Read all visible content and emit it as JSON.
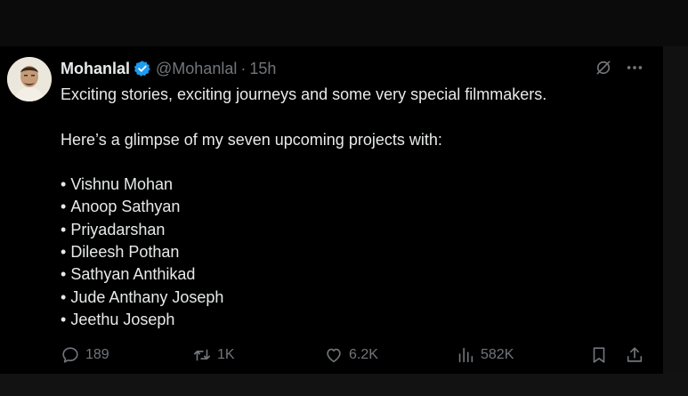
{
  "tweet": {
    "author_name": "Mohanlal",
    "handle": "@Mohanlal",
    "separator": "·",
    "time": "15h",
    "line1": "Exciting stories, exciting journeys and some very special filmmakers.",
    "line2": "Here’s a glimpse of my seven upcoming projects with:",
    "directors": [
      "Vishnu Mohan",
      "Anoop Sathyan",
      "Priyadarshan",
      "Dileesh Pothan",
      "Sathyan Anthikad",
      "Jude Anthany Joseph",
      "Jeethu Joseph"
    ]
  },
  "actions": {
    "replies": "189",
    "reposts": "1K",
    "likes": "6.2K",
    "views": "582K"
  },
  "icons": {
    "verified": "verified-badge-icon",
    "grok": "grok-icon",
    "more": "more-icon",
    "reply": "reply-icon",
    "repost": "repost-icon",
    "like": "heart-icon",
    "views": "views-icon",
    "bookmark": "bookmark-icon",
    "share": "share-icon"
  },
  "colors": {
    "background": "#000000",
    "text": "#e7e9ea",
    "muted": "#71767b",
    "verified": "#1d9bf0"
  }
}
